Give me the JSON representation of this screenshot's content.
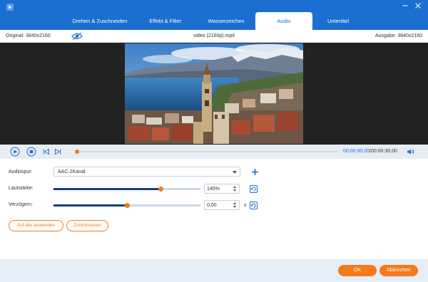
{
  "colors": {
    "accent": "#1b6fd0",
    "action": "#f37b1d",
    "slider_fill": "#1a3f78",
    "toolbar_bg": "#e7edf5"
  },
  "window": {
    "icons": [
      "app-logo-icon",
      "minimize-icon",
      "close-icon"
    ]
  },
  "tabs": [
    {
      "label": "Drehen & Zuschneiden",
      "active": false
    },
    {
      "label": "Effekt & Filter",
      "active": false
    },
    {
      "label": "Wasserzeichen",
      "active": false
    },
    {
      "label": "Audio",
      "active": true
    },
    {
      "label": "Untertitel",
      "active": false
    }
  ],
  "infobar": {
    "original": "Original: 3840x2160",
    "filename": "video (2160p).mp4",
    "output": "Ausgabe: 3840x2160"
  },
  "player": {
    "progress": 0.0,
    "time_current": "00:00:00.00",
    "time_separator": "/",
    "time_total": "00:00:30.00",
    "icons": [
      "play-icon",
      "stop-icon",
      "previous-frame-icon",
      "next-frame-icon",
      "volume-icon"
    ]
  },
  "audio": {
    "track_label": "Audiospur:",
    "track_value": "AAC-2Kanal",
    "volume_label": "Lautstärke:",
    "volume_value": "145%",
    "volume_level": 0.73,
    "delay_label": "Verzögern:",
    "delay_value": "0,00",
    "delay_level": 0.5,
    "delay_unit": "s"
  },
  "buttons": {
    "apply_all": "Auf alle anwenden",
    "reset": "Zurücksetzen",
    "ok": "OK",
    "cancel": "Abbrechen"
  }
}
